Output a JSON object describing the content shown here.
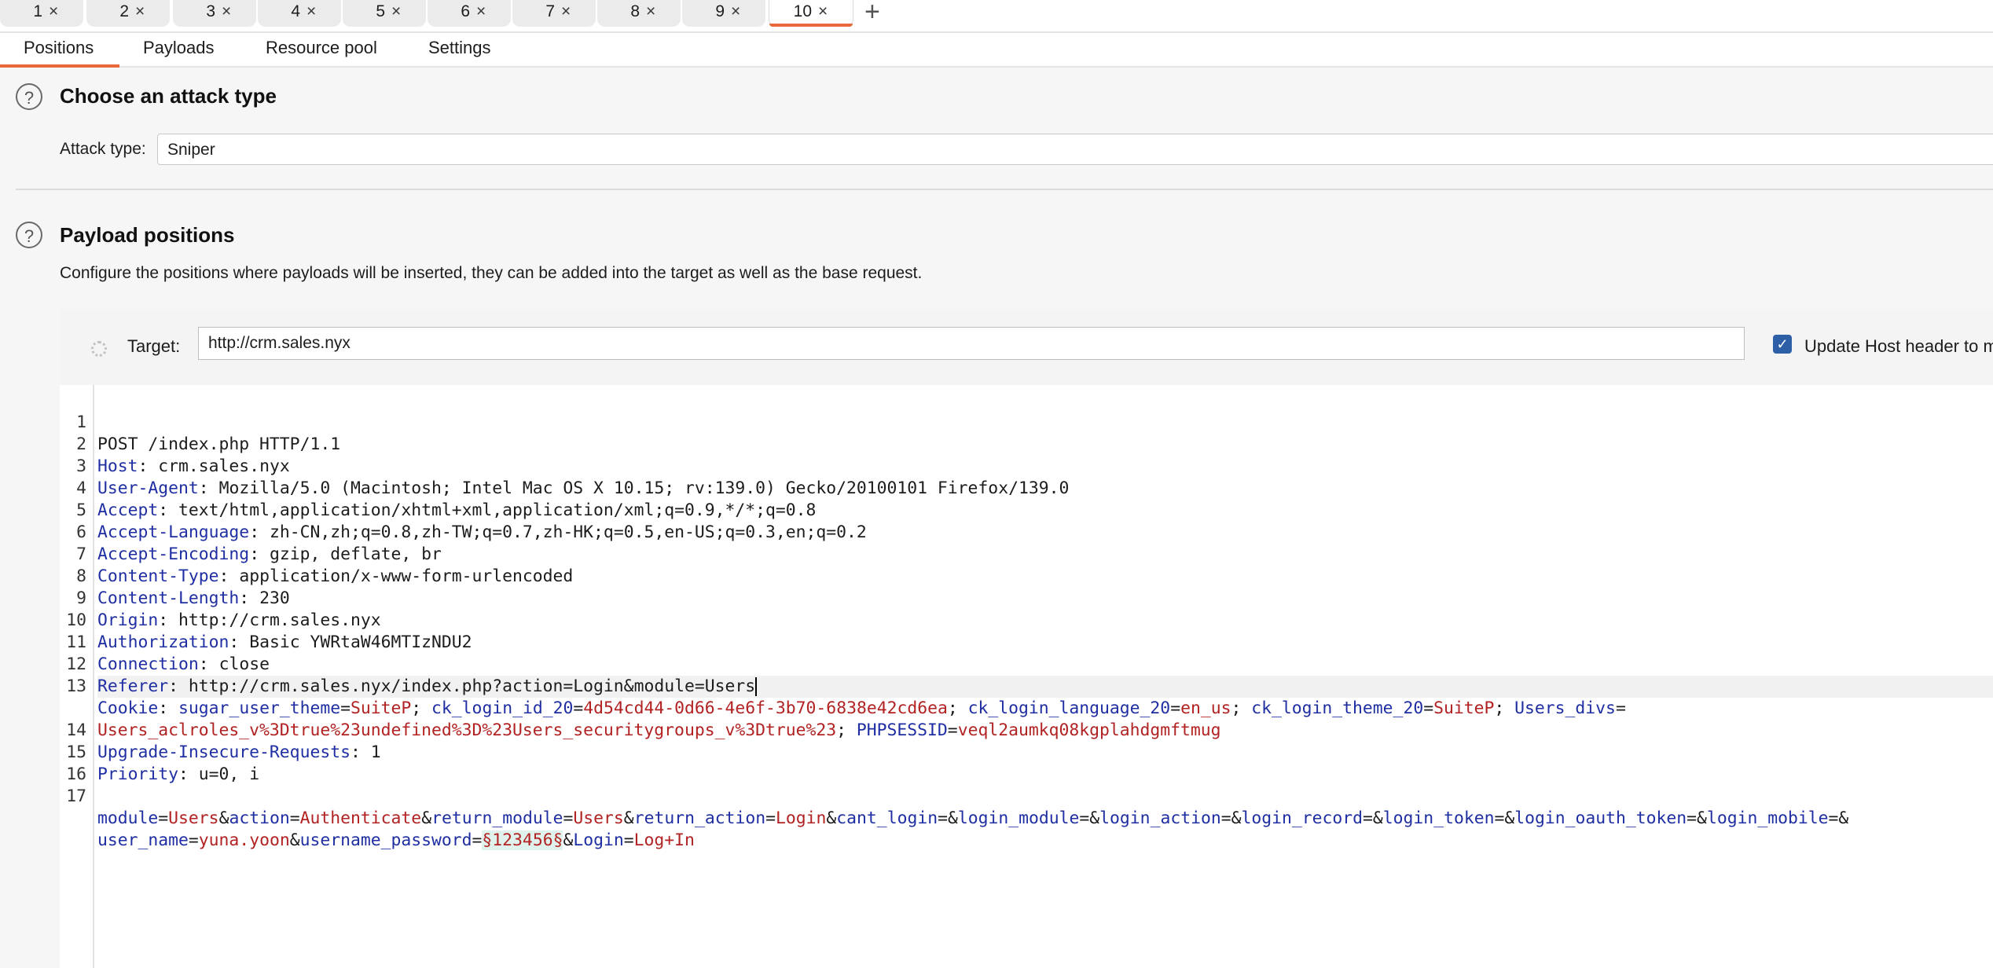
{
  "tabs": [
    {
      "label": "1",
      "close": "×"
    },
    {
      "label": "2",
      "close": "×"
    },
    {
      "label": "3",
      "close": "×"
    },
    {
      "label": "4",
      "close": "×"
    },
    {
      "label": "5",
      "close": "×"
    },
    {
      "label": "6",
      "close": "×"
    },
    {
      "label": "7",
      "close": "×"
    },
    {
      "label": "8",
      "close": "×"
    },
    {
      "label": "9",
      "close": "×"
    },
    {
      "label": "10",
      "close": "×"
    }
  ],
  "new_tab": "+",
  "subtabs": {
    "positions": "Positions",
    "payloads": "Payloads",
    "resource_pool": "Resource pool",
    "settings": "Settings"
  },
  "attack": {
    "help": "?",
    "title": "Choose an attack type",
    "type_label": "Attack type:",
    "type_value": "Sniper"
  },
  "payload_positions": {
    "help": "?",
    "title": "Payload positions",
    "description": "Configure the positions where payloads will be inserted, they can be added into the target as well as the base request.",
    "target_label": "Target:",
    "target_value": "http://crm.sales.nyx",
    "update_host_label": "Update Host header to m",
    "update_host_checked": true
  },
  "request": {
    "line_numbers": [
      "1",
      "2",
      "3",
      "4",
      "5",
      "6",
      "7",
      "8",
      "9",
      "10",
      "11",
      "12",
      "13",
      "",
      "14",
      "15",
      "16",
      "17",
      ""
    ],
    "l1": "POST /index.php HTTP/1.1",
    "headers": {
      "host": {
        "name": "Host",
        "value": "crm.sales.nyx"
      },
      "ua": {
        "name": "User-Agent",
        "value": "Mozilla/5.0 (Macintosh; Intel Mac OS X 10.15; rv:139.0) Gecko/20100101 Firefox/139.0"
      },
      "accept": {
        "name": "Accept",
        "value": "text/html,application/xhtml+xml,application/xml;q=0.9,*/*;q=0.8"
      },
      "lang": {
        "name": "Accept-Language",
        "value": "zh-CN,zh;q=0.8,zh-TW;q=0.7,zh-HK;q=0.5,en-US;q=0.3,en;q=0.2"
      },
      "enc": {
        "name": "Accept-Encoding",
        "value": "gzip, deflate, br"
      },
      "ctype": {
        "name": "Content-Type",
        "value": "application/x-www-form-urlencoded"
      },
      "clen": {
        "name": "Content-Length",
        "value": "230"
      },
      "origin": {
        "name": "Origin",
        "value": "http://crm.sales.nyx"
      },
      "auth": {
        "name": "Authorization",
        "value": "Basic YWRtaW46MTIzNDU2"
      },
      "conn": {
        "name": "Connection",
        "value": "close"
      },
      "referer": {
        "name": "Referer",
        "value": "http://crm.sales.nyx/index.php?action=Login&module=Users"
      },
      "cookie": {
        "name": "Cookie"
      },
      "uir": {
        "name": "Upgrade-Insecure-Requests",
        "value": "1"
      },
      "prio": {
        "name": "Priority",
        "value": "u=0, i"
      }
    },
    "cookie_params": [
      {
        "name": "sugar_user_theme",
        "value": "SuiteP"
      },
      {
        "name": "ck_login_id_20",
        "value": "4d54cd44-0d66-4e6f-3b70-6838e42cd6ea"
      },
      {
        "name": "ck_login_language_20",
        "value": "en_us"
      },
      {
        "name": "ck_login_theme_20",
        "value": "SuiteP"
      },
      {
        "name": "Users_divs",
        "value": ""
      },
      {
        "name": "",
        "value": "Users_aclroles_v%3Dtrue%23undefined%3D%23Users_securitygroups_v%3Dtrue%23"
      },
      {
        "name": "PHPSESSID",
        "value": "veql2aumkq08kgplahdgmftmug"
      }
    ],
    "body_params": [
      {
        "name": "module",
        "value": "Users"
      },
      {
        "name": "action",
        "value": "Authenticate"
      },
      {
        "name": "return_module",
        "value": "Users"
      },
      {
        "name": "return_action",
        "value": "Login"
      },
      {
        "name": "cant_login",
        "value": ""
      },
      {
        "name": "login_module",
        "value": ""
      },
      {
        "name": "login_action",
        "value": ""
      },
      {
        "name": "login_record",
        "value": ""
      },
      {
        "name": "login_token",
        "value": ""
      },
      {
        "name": "login_oauth_token",
        "value": ""
      },
      {
        "name": "login_mobile",
        "value": ""
      },
      {
        "name": "user_name",
        "value": "yuna.yoon"
      },
      {
        "name": "username_password",
        "value": "§123456§"
      },
      {
        "name": "Login",
        "value": "Log+In"
      }
    ]
  }
}
